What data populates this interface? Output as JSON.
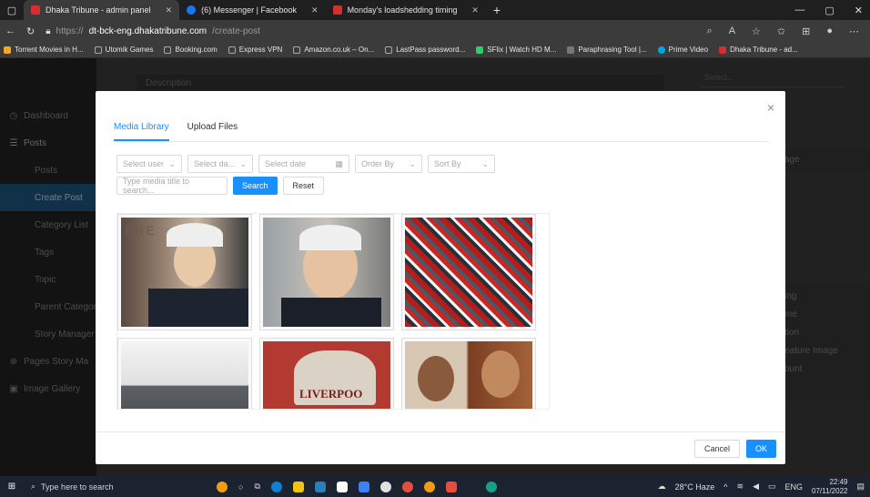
{
  "browser": {
    "tabs": [
      {
        "label": "Dhaka Tribune - admin panel",
        "favicon_color": "#d32f2f",
        "active": true
      },
      {
        "label": "(6) Messenger | Facebook",
        "favicon_color": "#1877f2",
        "active": false
      },
      {
        "label": "Monday's loadshedding timing",
        "favicon_color": "#d32f2f",
        "active": false
      }
    ],
    "new_tab": "+",
    "address": {
      "scheme": "https://",
      "host": "dt-bck-eng.dhakatribune.com",
      "path": "/create-post"
    },
    "bookmarks": [
      {
        "label": "Torrent Movies in H...",
        "color": "#f5a623"
      },
      {
        "label": "Utomik Games",
        "color": "#888888"
      },
      {
        "label": "Booking.com",
        "color": "#888888"
      },
      {
        "label": "Express VPN",
        "color": "#888888"
      },
      {
        "label": "Amazon.co.uk – On...",
        "color": "#888888"
      },
      {
        "label": "LastPass password...",
        "color": "#888888"
      },
      {
        "label": "SFlix | Watch HD M...",
        "color": "#2ecc71"
      },
      {
        "label": "Paraphrasing Tool |...",
        "color": "#888888"
      },
      {
        "label": "Prime Video",
        "color": "#00a8e1"
      },
      {
        "label": "Dhaka Tribune - ad...",
        "color": "#d32f2f"
      }
    ]
  },
  "sidebar": {
    "items": [
      {
        "label": "Dashboard",
        "icon": "dashboard-icon",
        "glyph": "◷",
        "sub": false,
        "active": false
      },
      {
        "label": "Posts",
        "icon": "posts-icon",
        "glyph": "☰",
        "sub": false,
        "active": false
      },
      {
        "label": "Posts",
        "icon": "",
        "glyph": "",
        "sub": true,
        "active": false
      },
      {
        "label": "Create Post",
        "icon": "",
        "glyph": "",
        "sub": true,
        "active": true
      },
      {
        "label": "Category List",
        "icon": "",
        "glyph": "",
        "sub": true,
        "active": false
      },
      {
        "label": "Tags",
        "icon": "",
        "glyph": "",
        "sub": true,
        "active": false
      },
      {
        "label": "Topic",
        "icon": "",
        "glyph": "",
        "sub": true,
        "active": false
      },
      {
        "label": "Parent Categorie",
        "icon": "",
        "glyph": "",
        "sub": true,
        "active": false
      },
      {
        "label": "Story Manager",
        "icon": "",
        "glyph": "",
        "sub": true,
        "active": false
      },
      {
        "label": "Pages Story Ma",
        "icon": "pages-icon",
        "glyph": "⊕",
        "sub": false,
        "active": false
      },
      {
        "label": "Image Gallery",
        "icon": "image-gallery-icon",
        "glyph": "▣",
        "sub": false,
        "active": false
      }
    ]
  },
  "background": {
    "description_label": "Description",
    "select_placeholder": "Select...",
    "right_fragments": [
      "age",
      "ing",
      "me",
      "tion",
      "eature Image",
      "ount"
    ]
  },
  "modal": {
    "tabs": [
      {
        "label": "Media Library",
        "active": true
      },
      {
        "label": "Upload Files",
        "active": false
      }
    ],
    "filters": {
      "select_user": "Select user",
      "select_date_type": "Select da...",
      "select_date": "Select date",
      "order_by": "Order By",
      "sort_by": "Sort By"
    },
    "search_placeholder": "Type media title to search...",
    "search_label": "Search",
    "reset_label": "Reset",
    "thumbnails": [
      {
        "alt": "man-with-glasses-1"
      },
      {
        "alt": "man-with-glasses-2"
      },
      {
        "alt": "rally-crowd"
      },
      {
        "alt": "industrial-machine"
      },
      {
        "alt": "liverpool-sign"
      },
      {
        "alt": "couple-portrait"
      }
    ],
    "cancel_label": "Cancel",
    "ok_label": "OK",
    "close_glyph": "×"
  },
  "taskbar": {
    "search_placeholder": "Type here to search",
    "weather": "28°C Haze",
    "language": "ENG",
    "time": "22:49",
    "date": "07/11/2022"
  }
}
